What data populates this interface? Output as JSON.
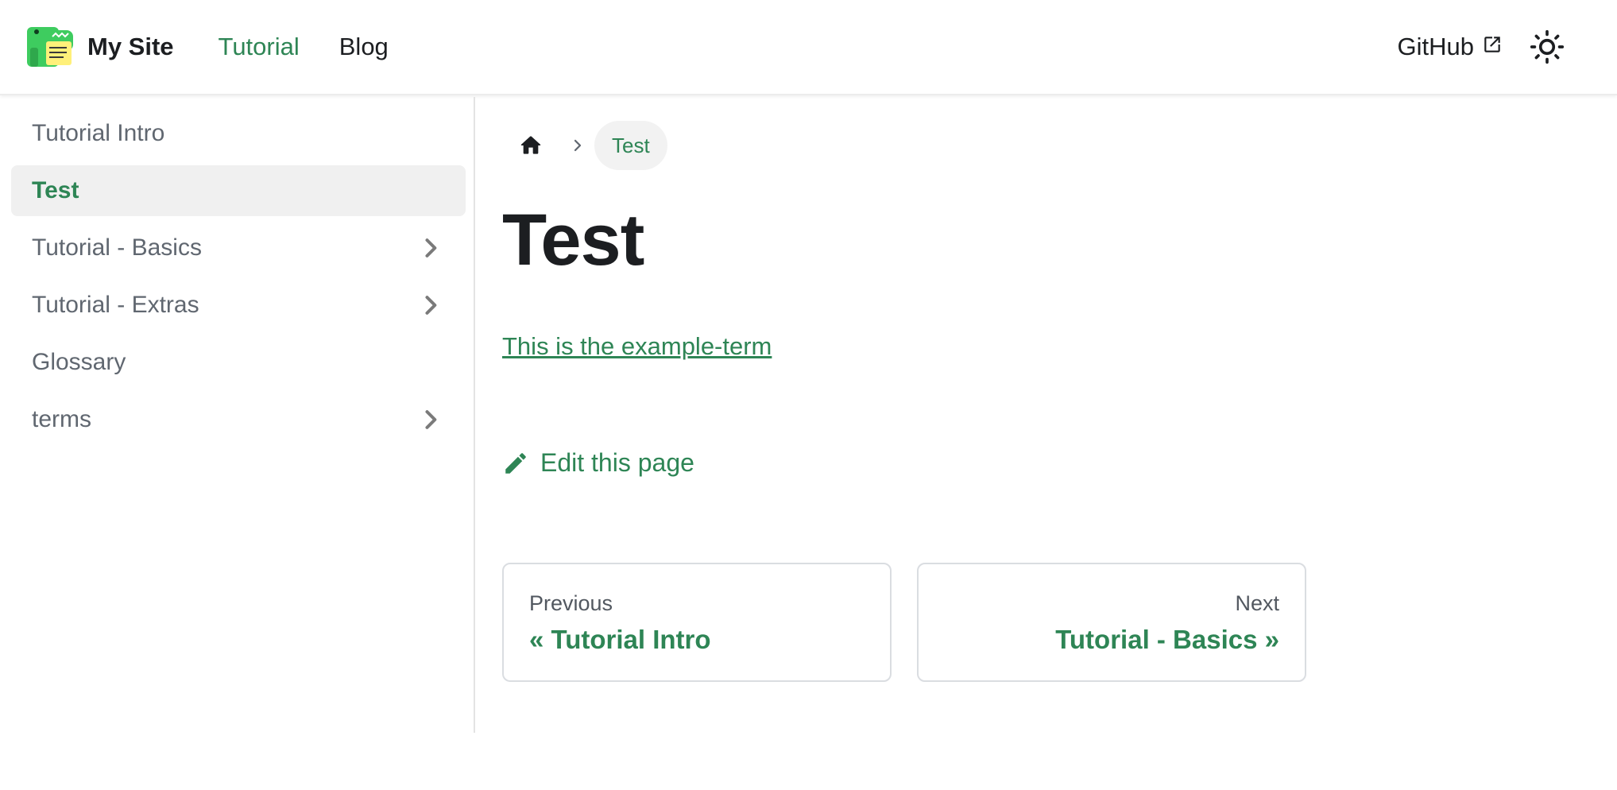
{
  "navbar": {
    "brand_title": "My Site",
    "links": [
      "Tutorial",
      "Blog"
    ],
    "github_label": "GitHub",
    "accent_color": "#2e8555"
  },
  "sidebar": {
    "items": [
      {
        "label": "Tutorial Intro",
        "active": false,
        "collapsible": false
      },
      {
        "label": "Test",
        "active": true,
        "collapsible": false
      },
      {
        "label": "Tutorial - Basics",
        "active": false,
        "collapsible": true
      },
      {
        "label": "Tutorial - Extras",
        "active": false,
        "collapsible": true
      },
      {
        "label": "Glossary",
        "active": false,
        "collapsible": false
      },
      {
        "label": "terms",
        "active": false,
        "collapsible": true
      }
    ]
  },
  "breadcrumb": {
    "current": "Test"
  },
  "main": {
    "title": "Test",
    "term_link": "This is the example-term",
    "edit_link": "Edit this page"
  },
  "pager": {
    "prev": {
      "sub": "Previous",
      "label": "« Tutorial Intro"
    },
    "next": {
      "sub": "Next",
      "label": "Tutorial - Basics »"
    }
  },
  "icons": [
    "dinosaur-logo-icon",
    "external-link-icon",
    "sun-icon",
    "chevron-right-icon",
    "home-icon",
    "pencil-icon"
  ]
}
